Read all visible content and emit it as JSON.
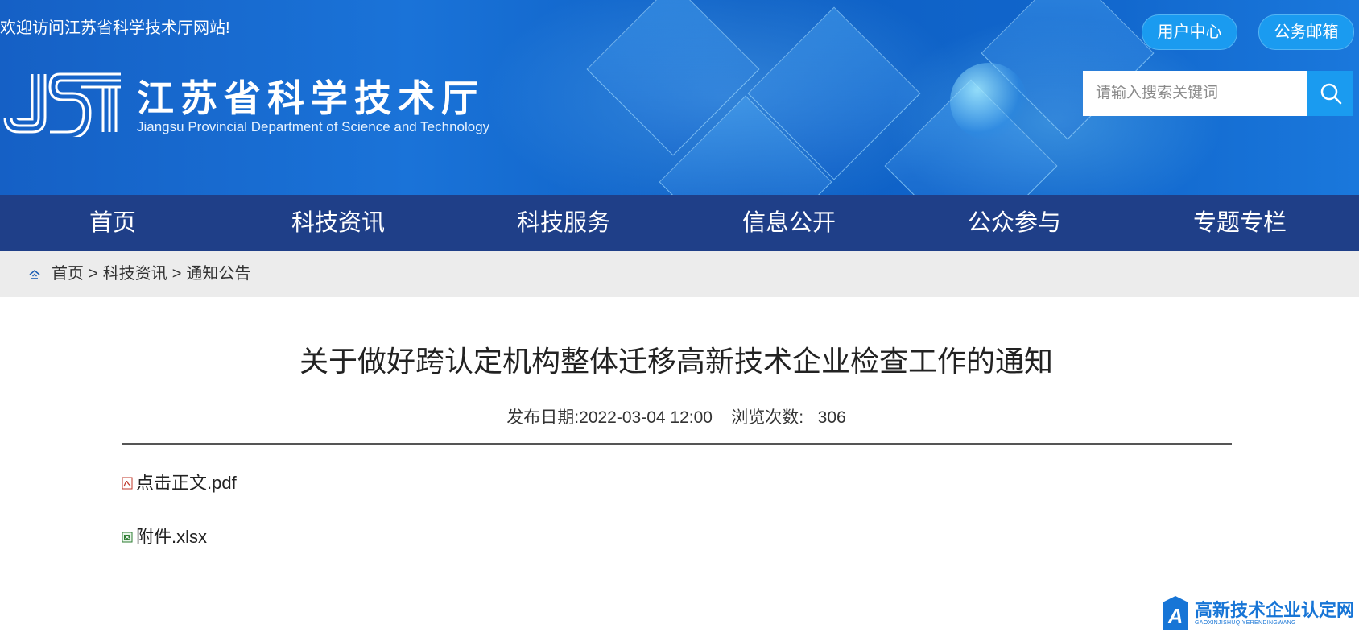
{
  "header": {
    "welcome": "欢迎访问江苏省科学技术厅网站!",
    "user_center": "用户中心",
    "mail": "公务邮箱",
    "logo_text": "JST",
    "site_title": "江苏省科学技术厅",
    "site_subtitle": "Jiangsu Provincial Department of Science and Technology",
    "search_placeholder": "请输入搜索关键词"
  },
  "nav": {
    "items": [
      {
        "label": "首页"
      },
      {
        "label": "科技资讯"
      },
      {
        "label": "科技服务"
      },
      {
        "label": "信息公开"
      },
      {
        "label": "公众参与"
      },
      {
        "label": "专题专栏"
      }
    ]
  },
  "breadcrumb": {
    "items": [
      "首页",
      "科技资讯",
      "通知公告"
    ],
    "separator": ">"
  },
  "article": {
    "title": "关于做好跨认定机构整体迁移高新技术企业检查工作的通知",
    "date_label": "发布日期:",
    "date_value": "2022-03-04 12:00",
    "views_label": "浏览次数:",
    "views_value": "306",
    "attachments": [
      {
        "name": "点击正文.pdf",
        "icon": "pdf-icon"
      },
      {
        "name": "附件.xlsx",
        "icon": "excel-icon"
      }
    ]
  },
  "watermark": {
    "title": "高新技术企业认定网",
    "subtitle": "GAOXINJISHUQIYERENDINGWANG"
  },
  "colors": {
    "banner_blue": "#1a6fd6",
    "nav_blue": "#1f3f88",
    "button_blue": "#1a9bf0",
    "breadcrumb_bg": "#ececec",
    "watermark_blue": "#1775d6"
  }
}
